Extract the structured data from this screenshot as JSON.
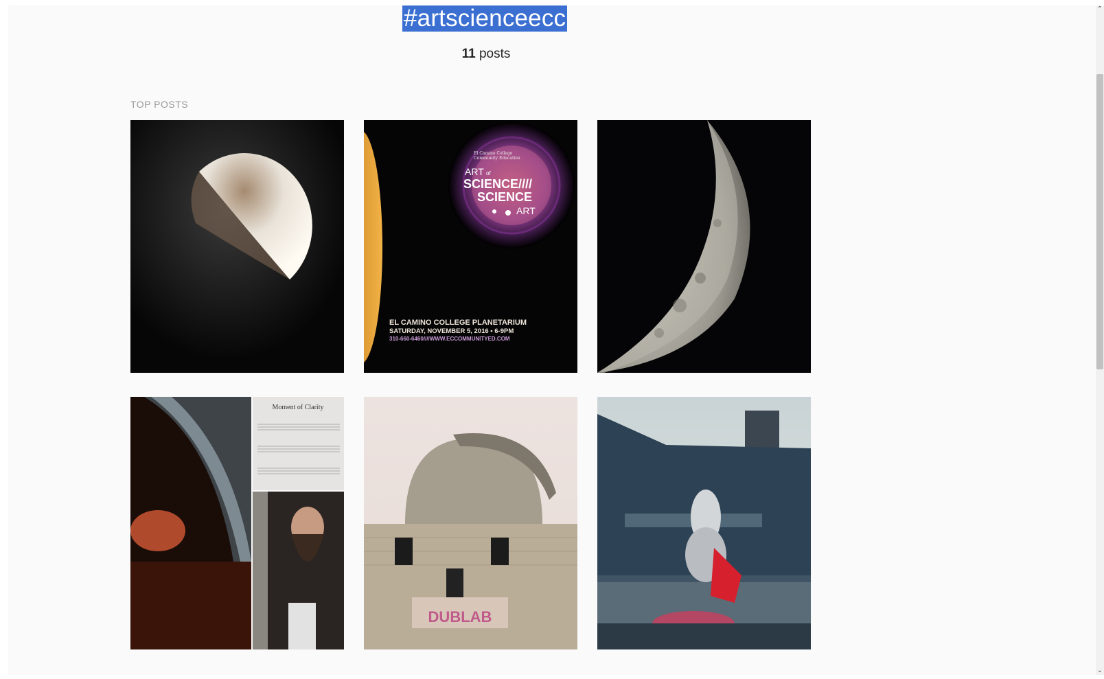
{
  "header": {
    "hashtag": "#artscienceecc",
    "post_count": "11",
    "post_count_suffix": "posts"
  },
  "section": {
    "title": "TOP POSTS"
  },
  "posts": [
    {
      "alt_icon": "moon-photo"
    },
    {
      "alt_icon": "event-poster",
      "poster_org_line1": "El Camino College",
      "poster_org_line2": "Community Education",
      "poster_art1": "ART",
      "poster_of": "of",
      "poster_science1": "SCIENCE////",
      "poster_science2": "SCIENCE",
      "poster_art2": "ART",
      "poster_line1": "EL CAMINO COLLEGE PLANETARIUM",
      "poster_line2": "SATURDAY, NOVEMBER 5, 2016 • 6-9PM",
      "poster_line3": "310-660-6460////WWW.ECCOMMUNITYED.COM"
    },
    {
      "alt_icon": "moon-closeup-photo"
    },
    {
      "alt_icon": "collage-photo",
      "sheet_title": "Moment of Clarity"
    },
    {
      "alt_icon": "observatory-photo",
      "banner": "DUBLAB"
    },
    {
      "alt_icon": "rooftop-photo"
    }
  ],
  "scrollbar": {
    "up": "⌃",
    "down": "⌄"
  }
}
